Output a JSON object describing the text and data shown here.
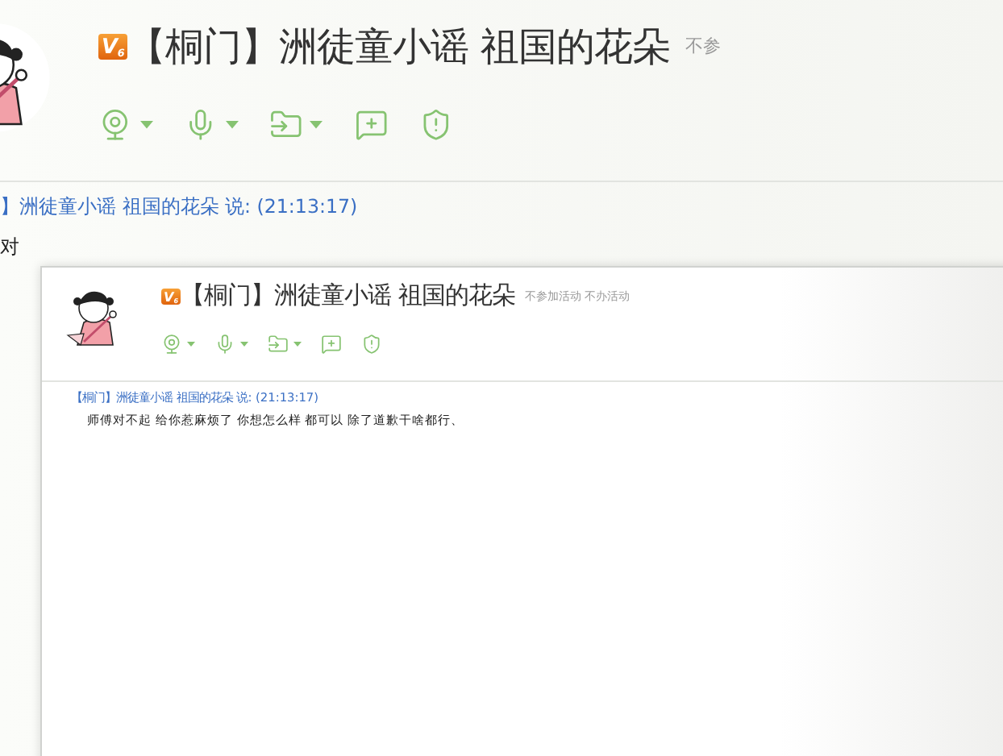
{
  "back_window": {
    "badge": "V",
    "badge_rank": "6",
    "title": "【桐门】洲徒童小谣 祖国的花朵",
    "status": "不参",
    "toolbar": [
      {
        "kind": "camera",
        "dropdown": true
      },
      {
        "kind": "mic",
        "dropdown": true
      },
      {
        "kind": "file",
        "dropdown": true
      },
      {
        "kind": "app",
        "dropdown": false
      },
      {
        "kind": "shield",
        "dropdown": false
      }
    ],
    "message": {
      "header": "】洲徒童小谣 祖国的花朵 说: (21:13:17)",
      "text": "对"
    }
  },
  "front_window": {
    "badge": "V",
    "badge_rank": "6",
    "title": "【桐门】洲徒童小谣 祖国的花朵",
    "status": "不参加活动 不办活动",
    "toolbar": [
      {
        "kind": "camera",
        "dropdown": true
      },
      {
        "kind": "mic",
        "dropdown": true
      },
      {
        "kind": "file",
        "dropdown": true
      },
      {
        "kind": "app",
        "dropdown": false
      },
      {
        "kind": "shield",
        "dropdown": false
      }
    ],
    "message": {
      "header": "【桐门】洲徒童小谣 祖国的花朵 说: (21:13:17)",
      "text": "师傅对不起 给你惹麻烦了 你想怎么样 都可以 除了道歉干啥都行、"
    }
  }
}
